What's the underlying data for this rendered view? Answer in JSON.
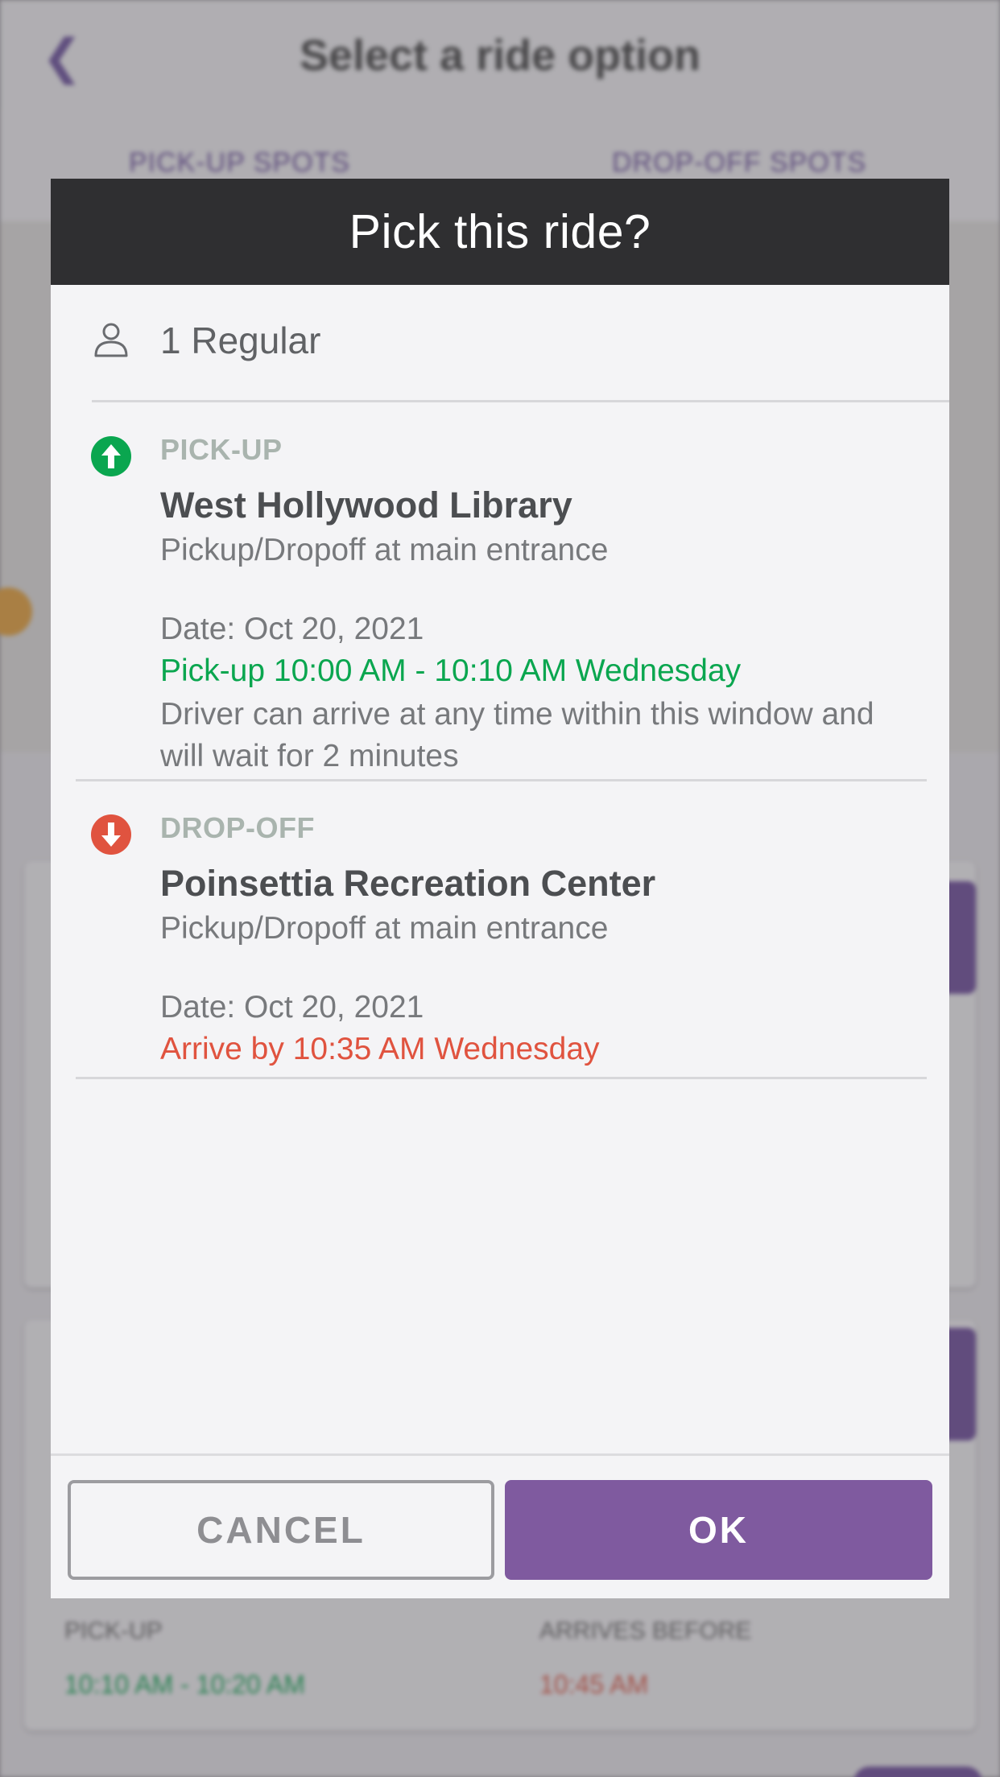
{
  "background": {
    "back_icon": "chevron-left-icon",
    "title": "Select a ride option",
    "tabs": [
      "PICK-UP SPOTS",
      "DROP-OFF SPOTS"
    ],
    "card_pickup_label": "PICK-UP",
    "card_pickup_time": "10:10 AM - 10:20 AM",
    "card_arrive_label": "ARRIVES BEFORE",
    "card_arrive_time": "10:45 AM"
  },
  "dialog": {
    "title": "Pick this ride?",
    "riders": {
      "icon": "person-icon",
      "text": "1 Regular"
    },
    "pickup": {
      "icon": "arrow-up-circle-icon",
      "type_label": "PICK-UP",
      "name": "West Hollywood Library",
      "note": "Pickup/Dropoff at main entrance",
      "date": "Date: Oct 20, 2021",
      "window": "Pick-up 10:00 AM - 10:10 AM Wednesday",
      "detail": "Driver can arrive at any time within this window and will wait for 2 minutes"
    },
    "dropoff": {
      "icon": "arrow-down-circle-icon",
      "type_label": "DROP-OFF",
      "name": "Poinsettia Recreation Center",
      "note": "Pickup/Dropoff at main entrance",
      "date": "Date: Oct 20, 2021",
      "window": "Arrive by 10:35 AM Wednesday"
    },
    "buttons": {
      "cancel": "CANCEL",
      "ok": "OK"
    }
  },
  "colors": {
    "header_bg": "#2f2f31",
    "accent_purple": "#7f5a9f",
    "pickup_green": "#0aa64f",
    "dropoff_red": "#e0533f"
  }
}
